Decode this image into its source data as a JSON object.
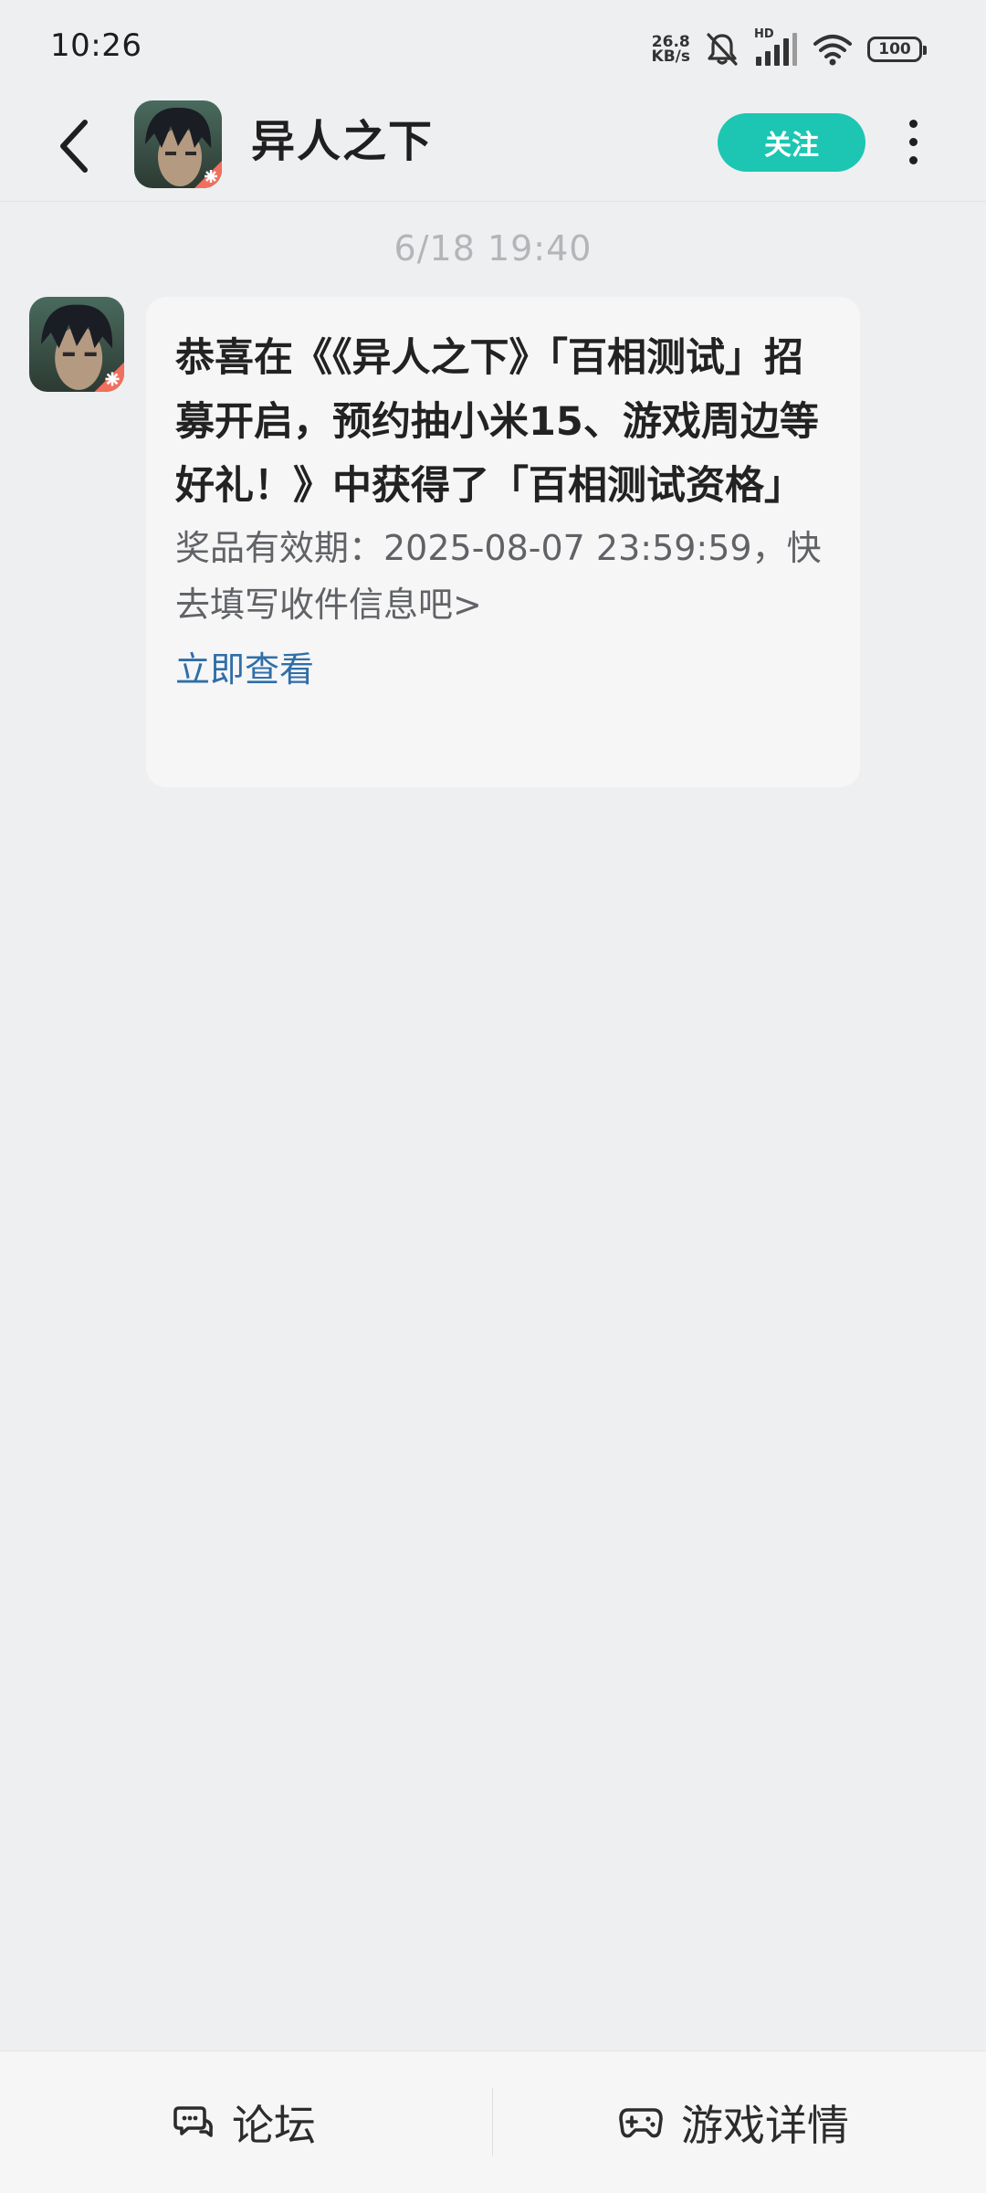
{
  "status_bar": {
    "time": "10:26",
    "net_speed_value": "26.8",
    "net_speed_unit": "KB/s",
    "network_badge": "HD",
    "battery": "100",
    "icons": [
      "mute-bell-icon",
      "signal-icon",
      "wifi-icon",
      "battery-icon"
    ]
  },
  "header": {
    "title": "异人之下",
    "follow_label": "关注",
    "icons": [
      "back-arrow-icon",
      "more-vertical-icon"
    ]
  },
  "chat": {
    "timestamp": "6/18  19:40",
    "message": {
      "title": "恭喜在《《异人之下》「百相测试」招募开启，预约抽小米15、游戏周边等好礼！》中获得了「百相测试资格」",
      "body": "奖品有效期：2025-08-07 23:59:59，快去填写收件信息吧>",
      "link": "立即查看"
    }
  },
  "bottom_bar": {
    "forum_label": "论坛",
    "details_label": "游戏详情",
    "icons": [
      "forum-chat-icon",
      "gamepad-icon"
    ]
  },
  "colors": {
    "accent": "#1cc6b2",
    "link": "#2f6ea8",
    "background": "#eeeff1",
    "bubble": "#f6f6f7"
  }
}
